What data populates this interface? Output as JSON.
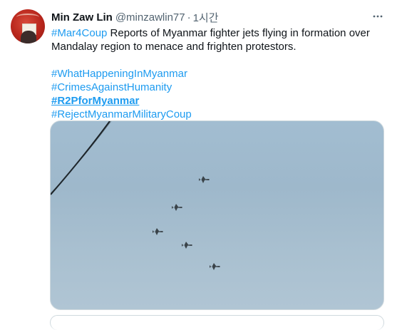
{
  "tweet": {
    "display_name": "Min Zaw Lin",
    "handle": "@minzawlin77",
    "separator": "·",
    "time": "1시간",
    "more_icon": "more-horizontal-icon",
    "body": {
      "hashtag_lead": "#Mar4Coup",
      "text": " Reports of Myanmar fighter jets flying in formation over Mandalay region to menace and frighten protestors."
    },
    "hashtags": [
      "#WhatHappeningInMyanmar",
      "#CrimesAgainstHumanity",
      "#R2PforMyanmar",
      "#RejectMyanmarMilitaryCoup"
    ],
    "media": {
      "description_icon": "photo",
      "jet_count": 5
    }
  },
  "colors": {
    "link": "#1d9bf0",
    "text": "#0f1419",
    "secondary": "#536471",
    "border": "#cfd9de",
    "sky": "#a2bdd1"
  }
}
